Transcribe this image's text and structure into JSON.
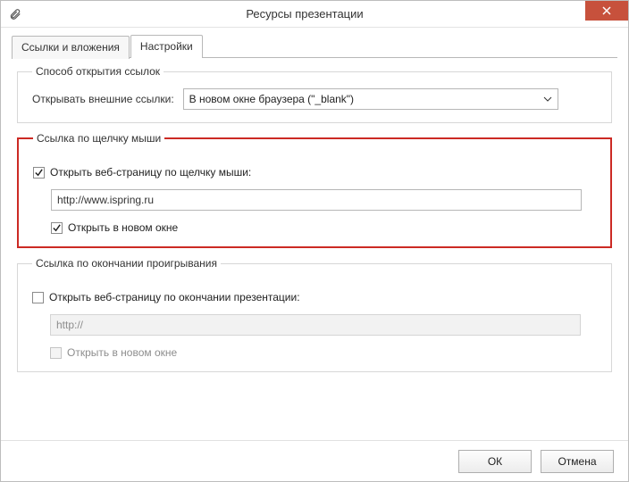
{
  "window": {
    "title": "Ресурсы презентации",
    "icon": "attachment-icon"
  },
  "tabs": {
    "links_attachments": "Ссылки и вложения",
    "settings": "Настройки"
  },
  "group_open_method": {
    "legend": "Способ открытия ссылок",
    "label": "Открывать внешние ссылки:",
    "select_value": "В новом окне браузера (\"_blank\")"
  },
  "group_click": {
    "legend": "Ссылка по щелчку мыши",
    "checkbox_open_label": "Открыть веб-страницу по щелчку мыши:",
    "checkbox_open_checked": true,
    "url_value": "http://www.ispring.ru",
    "checkbox_newwin_label": "Открыть в новом окне",
    "checkbox_newwin_checked": true
  },
  "group_end": {
    "legend": "Ссылка по окончании проигрывания",
    "checkbox_open_label": "Открыть веб-страницу по окончании презентации:",
    "checkbox_open_checked": false,
    "url_value": "http://",
    "checkbox_newwin_label": "Открыть в новом окне",
    "checkbox_newwin_checked": false,
    "disabled": true
  },
  "footer": {
    "ok": "ОК",
    "cancel": "Отмена"
  }
}
